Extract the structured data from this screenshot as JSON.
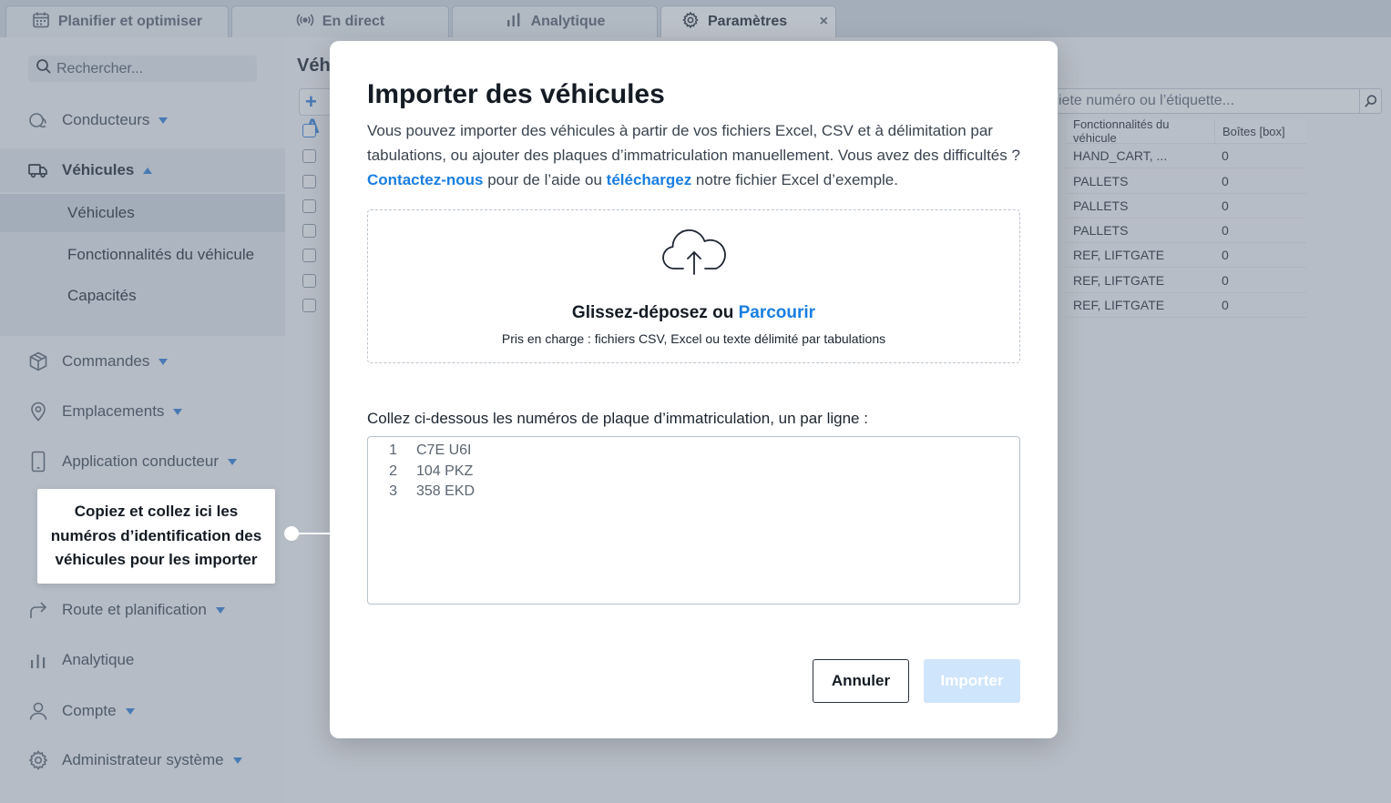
{
  "tabs": [
    {
      "label": "Planifier et optimiser",
      "icon": "calendar-icon"
    },
    {
      "label": "En direct",
      "icon": "broadcast-icon"
    },
    {
      "label": "Analytique",
      "icon": "bar-chart-icon"
    },
    {
      "label": "Paramètres",
      "icon": "gear-icon",
      "active": true
    }
  ],
  "tab_close": "×",
  "sidebar": {
    "search_placeholder": "Rechercher...",
    "items": [
      {
        "label": "Conducteurs",
        "icon": "drivers-icon"
      },
      {
        "label": "Véhicules",
        "icon": "truck-icon"
      },
      {
        "label": "Commandes",
        "icon": "package-icon"
      },
      {
        "label": "Emplacements",
        "icon": "location-pin-icon"
      },
      {
        "label": "Application conducteur",
        "icon": "phone-icon"
      },
      {
        "label": "Route et planification",
        "icon": "route-arrow-icon"
      },
      {
        "label": "Analytique",
        "icon": "bar-chart-icon"
      },
      {
        "label": "Compte",
        "icon": "user-icon"
      },
      {
        "label": "Administrateur système",
        "icon": "gear-icon"
      }
    ],
    "sub_items": [
      "Véhicules",
      "Fonctionnalités du véhicule",
      "Capacités"
    ]
  },
  "main": {
    "title": "Véh",
    "add_label": "+ A",
    "search_placeholder": "iete numéro ou l’étiquette...",
    "columns": [
      "Fonctionnalités du véhicule",
      "Boîtes [box]"
    ],
    "rows": [
      [
        "HAND_CART, ...",
        "0"
      ],
      [
        "PALLETS",
        "0"
      ],
      [
        "PALLETS",
        "0"
      ],
      [
        "PALLETS",
        "0"
      ],
      [
        "REF, LIFTGATE",
        "0"
      ],
      [
        "REF, LIFTGATE",
        "0"
      ],
      [
        "REF, LIFTGATE",
        "0"
      ]
    ]
  },
  "modal": {
    "title": "Importer des véhicules",
    "desc_part1": "Vous pouvez importer des véhicules à partir de vos fichiers Excel, CSV et à délimitation par tabulations, ou ajouter des plaques d’immatriculation manuellement. Vous avez des difficultés ?",
    "contact_link": "Contactez-nous",
    "desc_part2": " pour de l’aide ou ",
    "download_link": "téléchargez",
    "desc_part3": " notre fichier Excel d’exemple.",
    "dropzone_text": "Glissez-déposez ou ",
    "browse_link": "Parcourir",
    "dropzone_sub": "Pris en charge : fichiers CSV, Excel ou texte délimité par tabulations",
    "paste_label": "Collez ci-dessous les numéros de plaque d’immatriculation, un par ligne :",
    "plates": [
      {
        "num": "1",
        "value": "C7E U6I"
      },
      {
        "num": "2",
        "value": "104 PKZ"
      },
      {
        "num": "3",
        "value": "358 EKD"
      }
    ],
    "cancel_label": "Annuler",
    "import_label": "Importer"
  },
  "callout": "Copiez et collez ici les numéros d’identification des véhicules pour les importer",
  "colors": {
    "accent": "#1a7ee0",
    "caret": "#2f7fd9",
    "import_disabled": "#cfe5fb"
  }
}
